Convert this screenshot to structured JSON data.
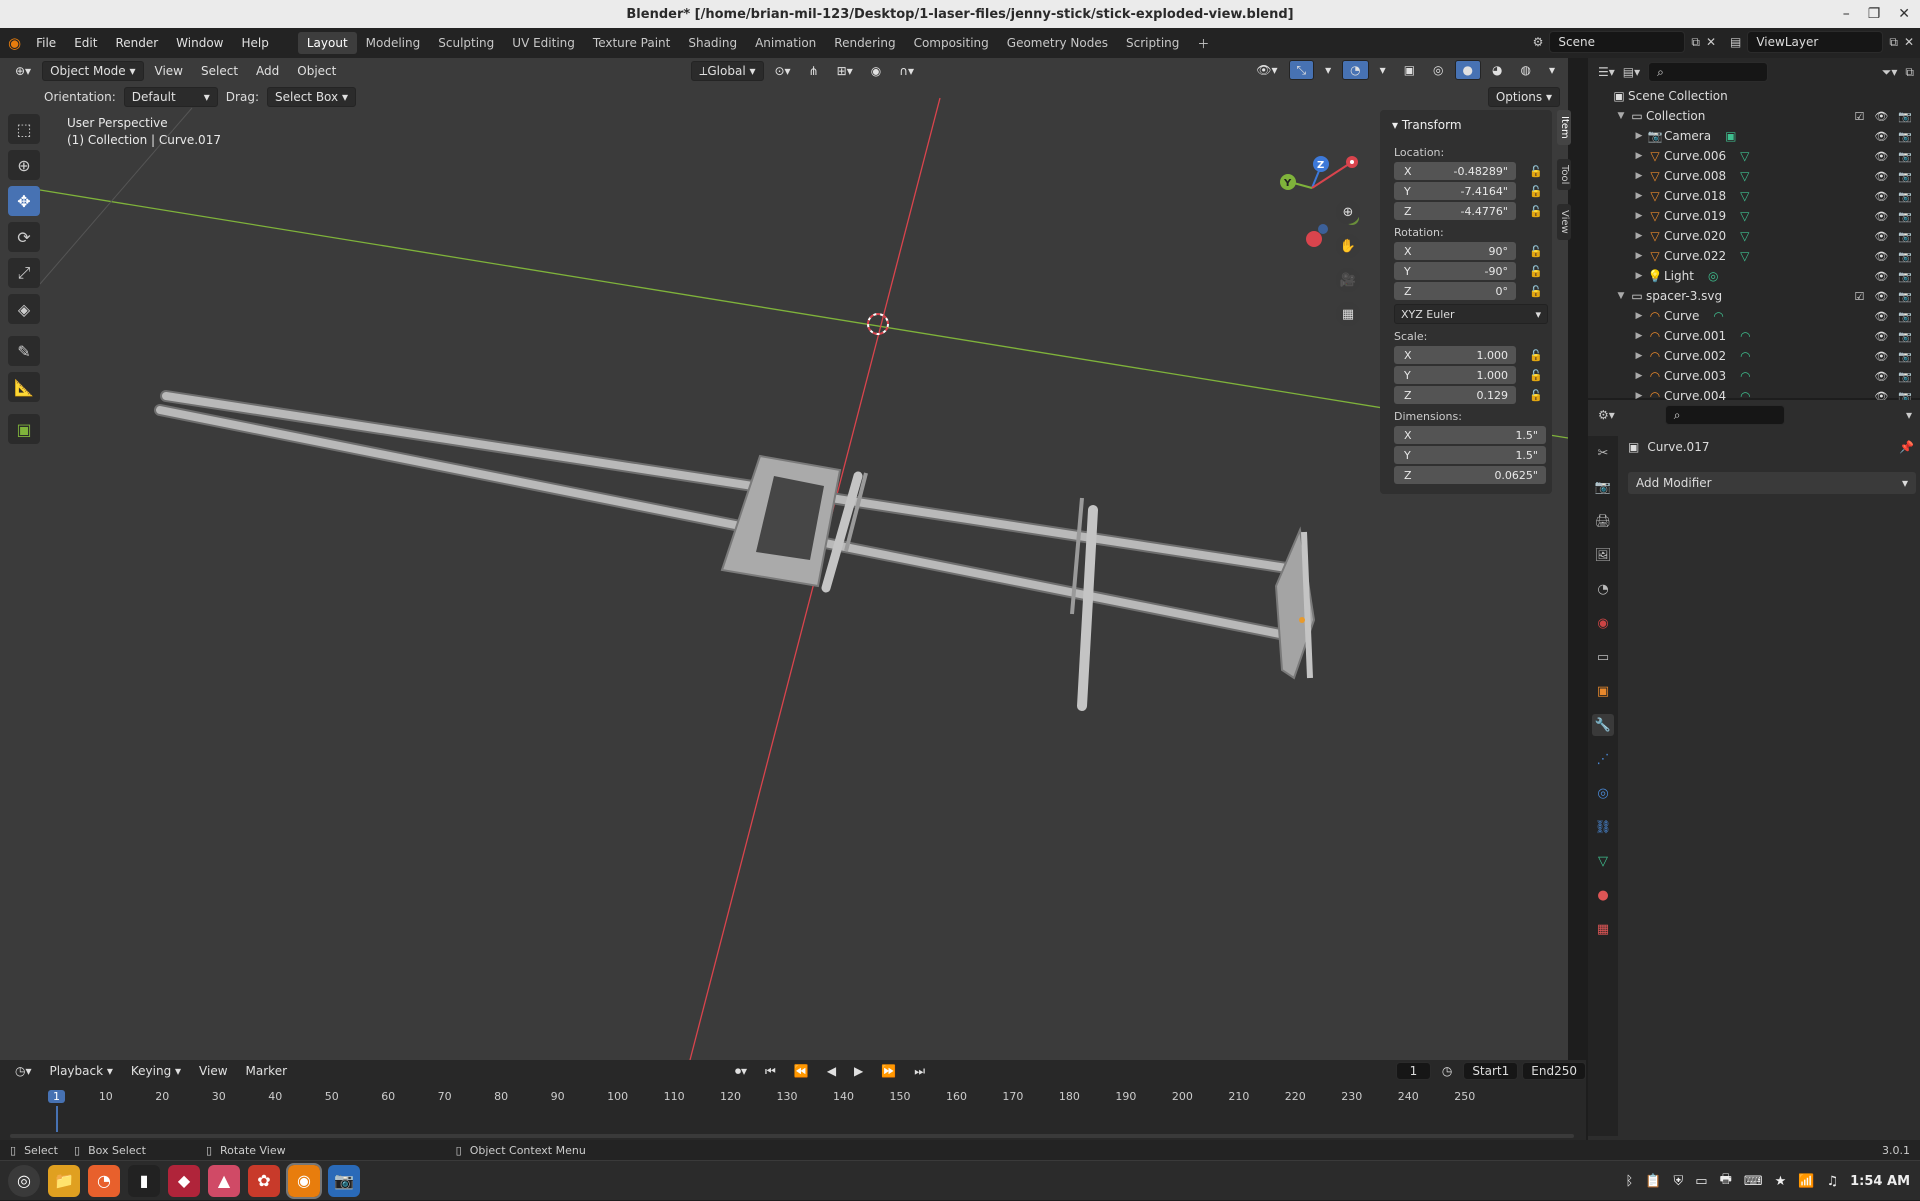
{
  "window": {
    "title": "Blender* [/home/brian-mil-123/Desktop/1-laser-files/jenny-stick/stick-exploded-view.blend]"
  },
  "menu": [
    "File",
    "Edit",
    "Render",
    "Window",
    "Help"
  ],
  "workspaces": [
    "Layout",
    "Modeling",
    "Sculpting",
    "UV Editing",
    "Texture Paint",
    "Shading",
    "Animation",
    "Rendering",
    "Compositing",
    "Geometry Nodes",
    "Scripting"
  ],
  "active_workspace": "Layout",
  "scene": {
    "name": "Scene",
    "view_layer": "ViewLayer"
  },
  "viewport": {
    "mode": "Object Mode",
    "menus": [
      "View",
      "Select",
      "Add",
      "Object"
    ],
    "transform_orientation": "Global",
    "orientation_label": "Orientation:",
    "orientation_value": "Default",
    "drag_label": "Drag:",
    "drag_value": "Select Box",
    "options": "Options",
    "perspective": "User Perspective",
    "collection_info": "(1) Collection | Curve.017",
    "tools": [
      "select-box",
      "cursor",
      "move",
      "rotate",
      "scale",
      "transform",
      "annotate",
      "measure",
      "add-cube"
    ],
    "gizmo_axes": [
      "X",
      "Y",
      "Z"
    ],
    "colors": {
      "x_axis": "#d9444d",
      "y_axis": "#7fb33b",
      "z_axis": "#3d79d9",
      "bg": "#3b3b3b",
      "select": "#4772b3"
    }
  },
  "npanel": {
    "title": "Transform",
    "location_label": "Location:",
    "location": [
      {
        "axis": "X",
        "value": "-0.48289\""
      },
      {
        "axis": "Y",
        "value": "-7.4164\""
      },
      {
        "axis": "Z",
        "value": "-4.4776\""
      }
    ],
    "rotation_label": "Rotation:",
    "rotation": [
      {
        "axis": "X",
        "value": "90°"
      },
      {
        "axis": "Y",
        "value": "-90°"
      },
      {
        "axis": "Z",
        "value": "0°"
      }
    ],
    "rotation_mode": "XYZ Euler",
    "scale_label": "Scale:",
    "scale": [
      {
        "axis": "X",
        "value": "1.000"
      },
      {
        "axis": "Y",
        "value": "1.000"
      },
      {
        "axis": "Z",
        "value": "0.129"
      }
    ],
    "dimensions_label": "Dimensions:",
    "dimensions": [
      {
        "axis": "X",
        "value": "1.5\""
      },
      {
        "axis": "Y",
        "value": "1.5\""
      },
      {
        "axis": "Z",
        "value": "0.0625\""
      }
    ],
    "tabs": [
      "Item",
      "Tool",
      "View"
    ]
  },
  "outliner": {
    "root": "Scene Collection",
    "collections": [
      {
        "name": "Collection",
        "items": [
          {
            "name": "Camera",
            "icon": "camera"
          },
          {
            "name": "Curve.006",
            "icon": "mesh"
          },
          {
            "name": "Curve.008",
            "icon": "mesh"
          },
          {
            "name": "Curve.018",
            "icon": "mesh"
          },
          {
            "name": "Curve.019",
            "icon": "mesh"
          },
          {
            "name": "Curve.020",
            "icon": "mesh"
          },
          {
            "name": "Curve.022",
            "icon": "mesh"
          },
          {
            "name": "Light",
            "icon": "light"
          }
        ]
      },
      {
        "name": "spacer-3.svg",
        "items": [
          {
            "name": "Curve",
            "icon": "curve"
          },
          {
            "name": "Curve.001",
            "icon": "curve"
          },
          {
            "name": "Curve.002",
            "icon": "curve"
          },
          {
            "name": "Curve.003",
            "icon": "curve"
          },
          {
            "name": "Curve.004",
            "icon": "curve"
          }
        ]
      }
    ]
  },
  "properties": {
    "object": "Curve.017",
    "add_modifier": "Add Modifier"
  },
  "timeline": {
    "menus": [
      "Playback",
      "Keying",
      "View",
      "Marker"
    ],
    "current_frame": "1",
    "start_label": "Start",
    "start": "1",
    "end_label": "End",
    "end": "250",
    "ticks": [
      "1",
      "10",
      "20",
      "30",
      "40",
      "50",
      "60",
      "70",
      "80",
      "90",
      "100",
      "110",
      "120",
      "130",
      "140",
      "150",
      "160",
      "170",
      "180",
      "190",
      "200",
      "210",
      "220",
      "230",
      "240",
      "250"
    ]
  },
  "status": {
    "select": "Select",
    "box_select": "Box Select",
    "rotate_view": "Rotate View",
    "context_menu": "Object Context Menu",
    "version": "3.0.1"
  },
  "taskbar": {
    "clock": "1:54 AM"
  }
}
